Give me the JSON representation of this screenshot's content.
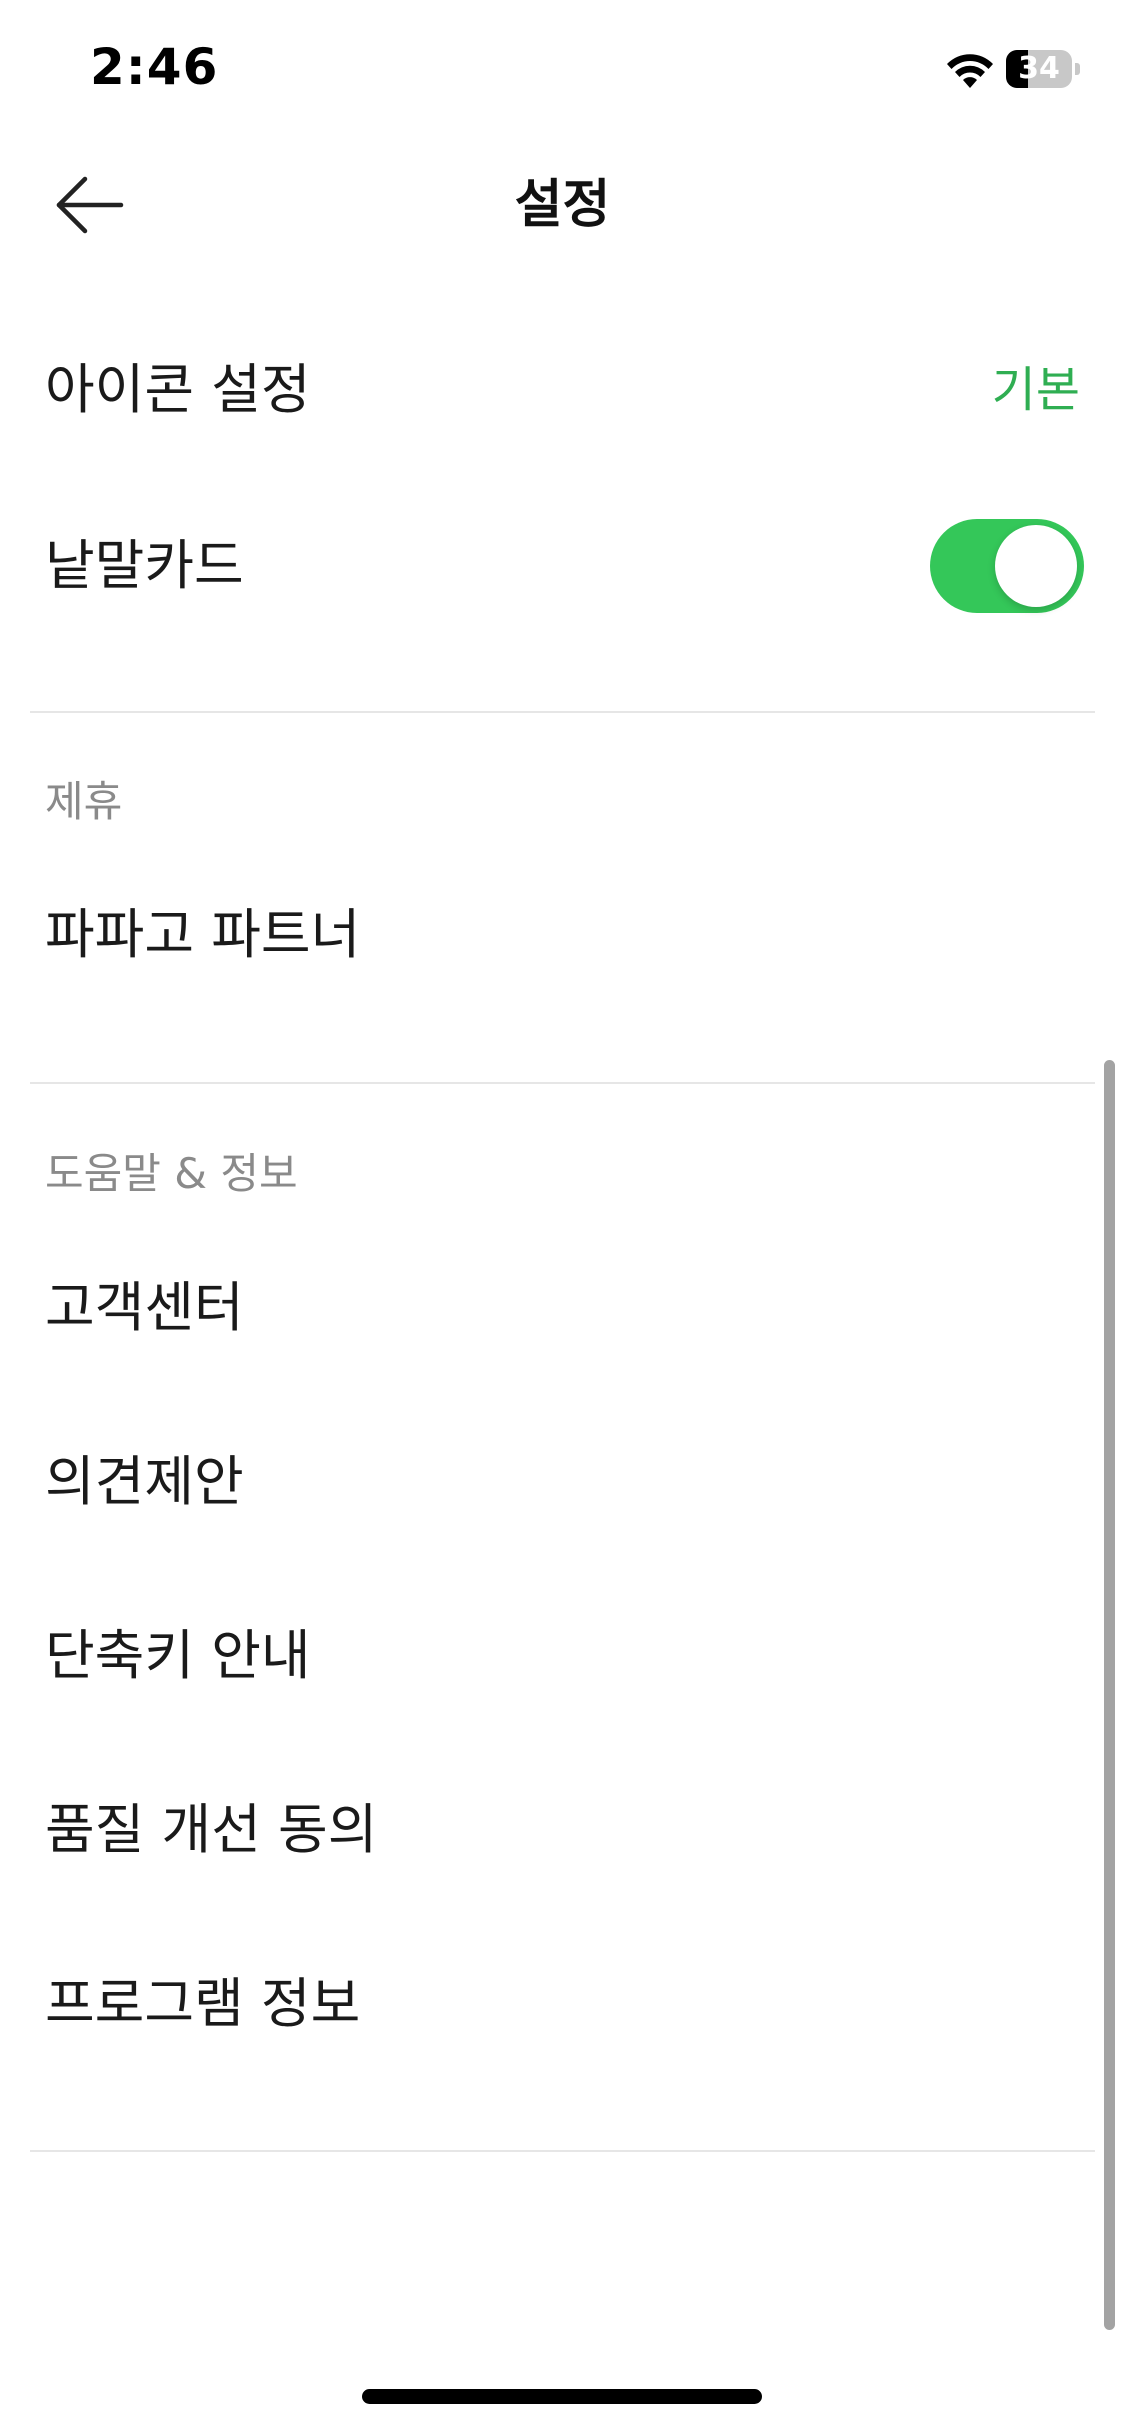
{
  "status_bar": {
    "time": "2:46",
    "battery_level": "34",
    "battery_fraction": 0.34,
    "wifi_icon": "wifi-icon",
    "battery_icon": "battery-icon"
  },
  "nav": {
    "title": "설정",
    "back_icon": "arrow-left-icon"
  },
  "colors": {
    "accent": "#34c759",
    "accent_text": "#2fae52",
    "section_text": "#8a8a8a",
    "divider": "#e6e6e6"
  },
  "settings": {
    "icon_setting": {
      "label": "아이콘 설정",
      "value": "기본"
    },
    "word_card": {
      "label": "낱말카드",
      "toggle_on": true
    }
  },
  "sections": {
    "partnership": {
      "header": "제휴",
      "items": [
        {
          "label": "파파고 파트너"
        }
      ]
    },
    "help": {
      "header": "도움말 & 정보",
      "items": [
        {
          "label": "고객센터"
        },
        {
          "label": "의견제안"
        },
        {
          "label": "단축키 안내"
        },
        {
          "label": "품질 개선 동의"
        },
        {
          "label": "프로그램 정보"
        }
      ]
    }
  }
}
